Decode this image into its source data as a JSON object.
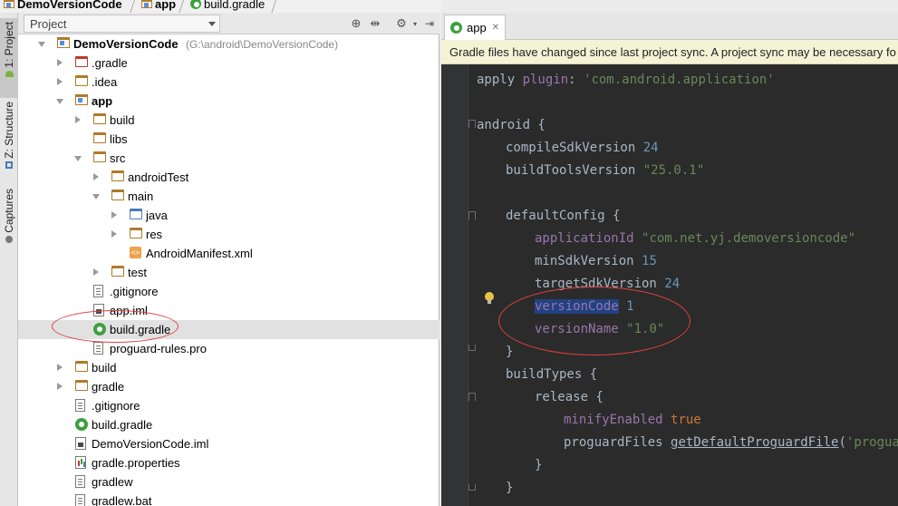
{
  "breadcrumb": {
    "items": [
      "DemoVersionCode",
      "app",
      "build.gradle"
    ]
  },
  "left_stripe": {
    "tabs": [
      "1: Project",
      "Z: Structure",
      "Captures"
    ]
  },
  "project_panel": {
    "view_selector": "Project",
    "tree": [
      {
        "label": "DemoVersionCode",
        "path": "(G:\\android\\DemoVersionCode)",
        "icon": "module-icon",
        "toggle": "down",
        "bold": true
      },
      {
        "label": ".gradle",
        "icon": "folder-red-icon",
        "toggle": "right"
      },
      {
        "label": ".idea",
        "icon": "folder-icon",
        "toggle": "right"
      },
      {
        "label": "app",
        "icon": "module-icon",
        "toggle": "down",
        "bold": true
      },
      {
        "label": "build",
        "icon": "folder-icon",
        "toggle": "right"
      },
      {
        "label": "libs",
        "icon": "folder-icon",
        "toggle": "none"
      },
      {
        "label": "src",
        "icon": "folder-icon",
        "toggle": "down"
      },
      {
        "label": "androidTest",
        "icon": "folder-icon",
        "toggle": "right"
      },
      {
        "label": "main",
        "icon": "folder-icon",
        "toggle": "down"
      },
      {
        "label": "java",
        "icon": "folder-blue-icon",
        "toggle": "right"
      },
      {
        "label": "res",
        "icon": "folder-icon",
        "toggle": "right"
      },
      {
        "label": "AndroidManifest.xml",
        "icon": "xml-file-icon",
        "toggle": "none"
      },
      {
        "label": "test",
        "icon": "folder-icon",
        "toggle": "right"
      },
      {
        "label": ".gitignore",
        "icon": "file-icon",
        "toggle": "none"
      },
      {
        "label": "app.iml",
        "icon": "iml-file-icon",
        "toggle": "none"
      },
      {
        "label": "build.gradle",
        "icon": "gradle-icon",
        "toggle": "none",
        "selected": true
      },
      {
        "label": "proguard-rules.pro",
        "icon": "file-icon",
        "toggle": "none"
      },
      {
        "label": "build",
        "icon": "folder-icon",
        "toggle": "right"
      },
      {
        "label": "gradle",
        "icon": "folder-icon",
        "toggle": "right"
      },
      {
        "label": ".gitignore",
        "icon": "file-icon",
        "toggle": "none"
      },
      {
        "label": "build.gradle",
        "icon": "gradle-icon",
        "toggle": "none"
      },
      {
        "label": "DemoVersionCode.iml",
        "icon": "iml-file-icon",
        "toggle": "none"
      },
      {
        "label": "gradle.properties",
        "icon": "properties-file-icon",
        "toggle": "none"
      },
      {
        "label": "gradlew",
        "icon": "file-icon",
        "toggle": "none"
      },
      {
        "label": "gradlew.bat",
        "icon": "file-icon",
        "toggle": "none"
      }
    ]
  },
  "editor": {
    "tab_label": "app",
    "sync_banner": "Gradle files have changed since last project sync. A project sync may be necessary fo",
    "code": {
      "l1_a": "apply ",
      "l1_b": "plugin",
      "l1_c": ": ",
      "l1_d": "'com.android.application'",
      "l3": "android {",
      "l4_a": "compileSdkVersion ",
      "l4_b": "24",
      "l5_a": "buildToolsVersion ",
      "l5_b": "\"25.0.1\"",
      "l7": "defaultConfig {",
      "l8_a": "applicationId ",
      "l8_b": "\"com.net.yj.demoversioncode\"",
      "l9_a": "minSdkVersion ",
      "l9_b": "15",
      "l10_a": "targetSdkVersion ",
      "l10_b": "24",
      "l11_a": "versionCode",
      "l11_b": " ",
      "l11_c": "1",
      "l12_a": "versionName ",
      "l12_b": "\"1.0\"",
      "l13": "}",
      "l14": "buildTypes {",
      "l15": "release {",
      "l16_a": "minifyEnabled ",
      "l16_b": "true",
      "l17_a": "proguardFiles ",
      "l17_b": "getDefaultProguardFile",
      "l17_c": "(",
      "l17_d": "'proguard",
      "l18": "}",
      "l19": "}"
    }
  },
  "colors": {
    "annotation": "#e04040",
    "editor_bg": "#2b2b2b",
    "keyword": "#cc7832",
    "string": "#6a8759",
    "number": "#6897bb",
    "selection": "#214283"
  }
}
